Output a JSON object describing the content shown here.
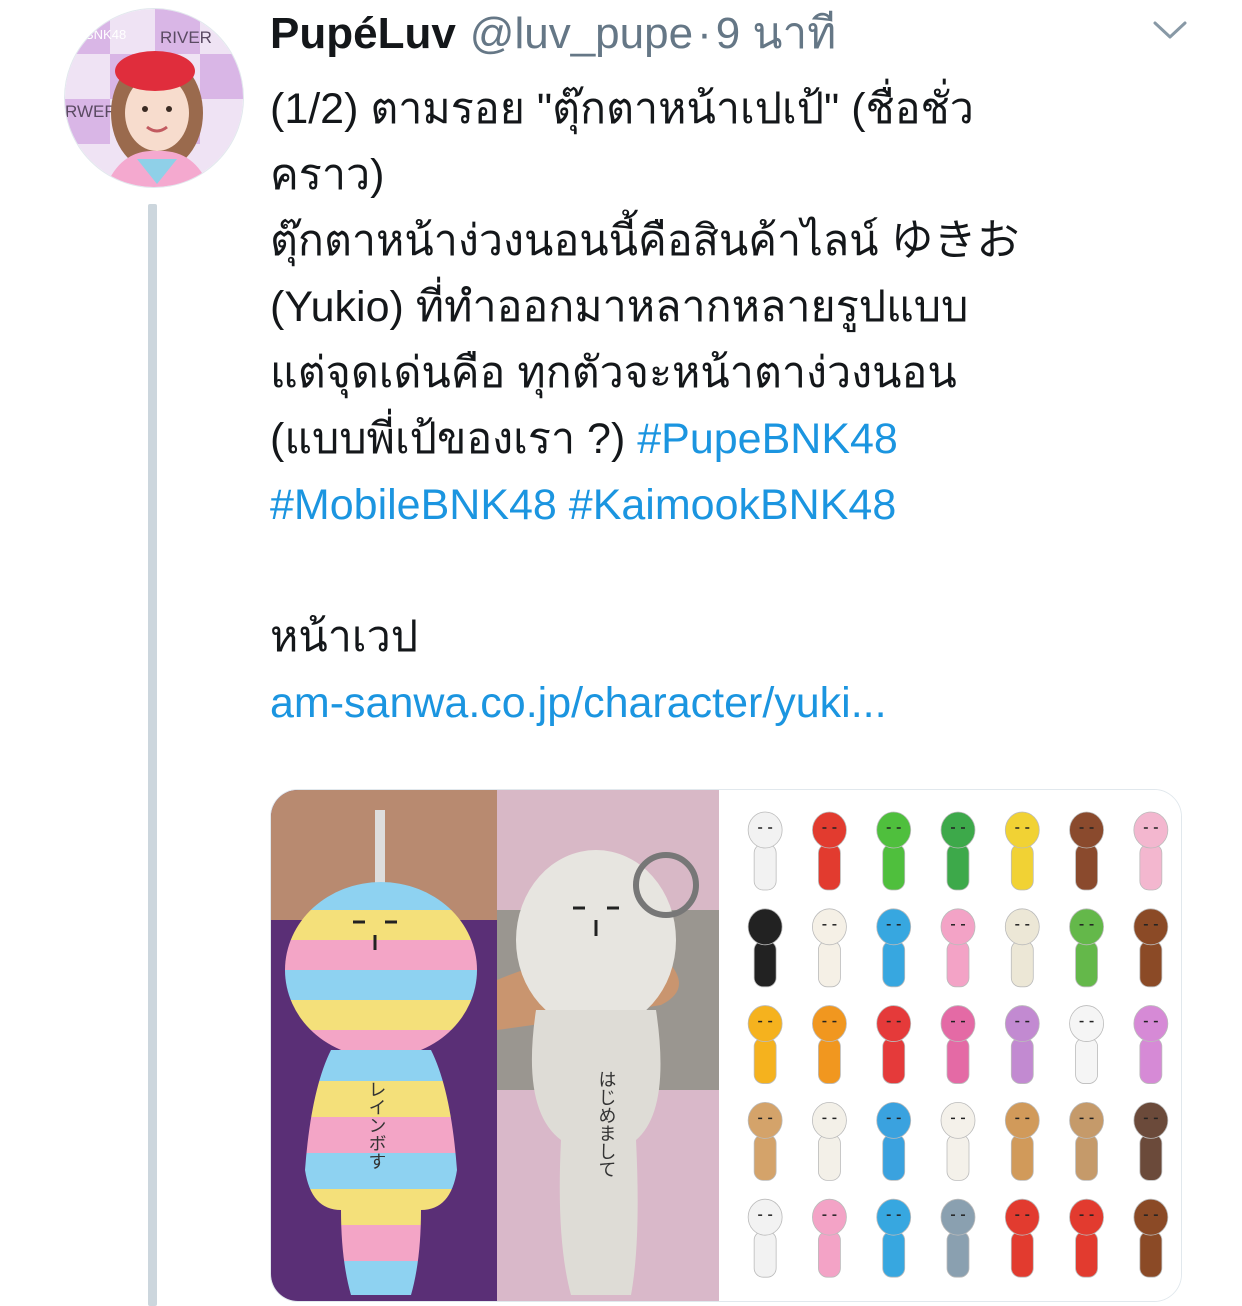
{
  "tweet": {
    "display_name": "PupéLuv",
    "handle": "@luv_pupe",
    "separator": "·",
    "timestamp": "9 นาที",
    "text_lines": [
      "(1/2) ตามรอย \"ตุ๊กตาหน้าเปเป้\" (ชื่อชั่ว",
      "คราว)",
      "ตุ๊กตาหน้าง่วงนอนนี้คือสินค้าไลน์ ゆきお",
      "(Yukio) ที่ทำออกมาหลากหลายรูปแบบ",
      "แต่จุดเด่นคือ ทุกตัวจะหน้าตาง่วงนอน"
    ],
    "line6_text": "(แบบพี่เป้ของเรา ?) ",
    "hashtags": [
      "#PupeBNK48",
      "#MobileBNK48",
      "#KaimookBNK48"
    ],
    "website_label": "หน้าเวป",
    "link_text": "am-sanwa.co.jp/character/yuki..."
  },
  "avatar": {
    "backdrop_text_1": "RIVER",
    "backdrop_text_2": "RWER",
    "backdrop_text_3": "BNK48"
  },
  "photos": {
    "left_doll_1_text": "レインボす",
    "left_doll_2_text": "はじめまして"
  },
  "icons": {
    "menu": "chevron-down-icon"
  },
  "colors": {
    "link": "#1b95e0",
    "text": "#14171a",
    "secondary": "#657786",
    "thread_line": "#ccd6dd"
  }
}
